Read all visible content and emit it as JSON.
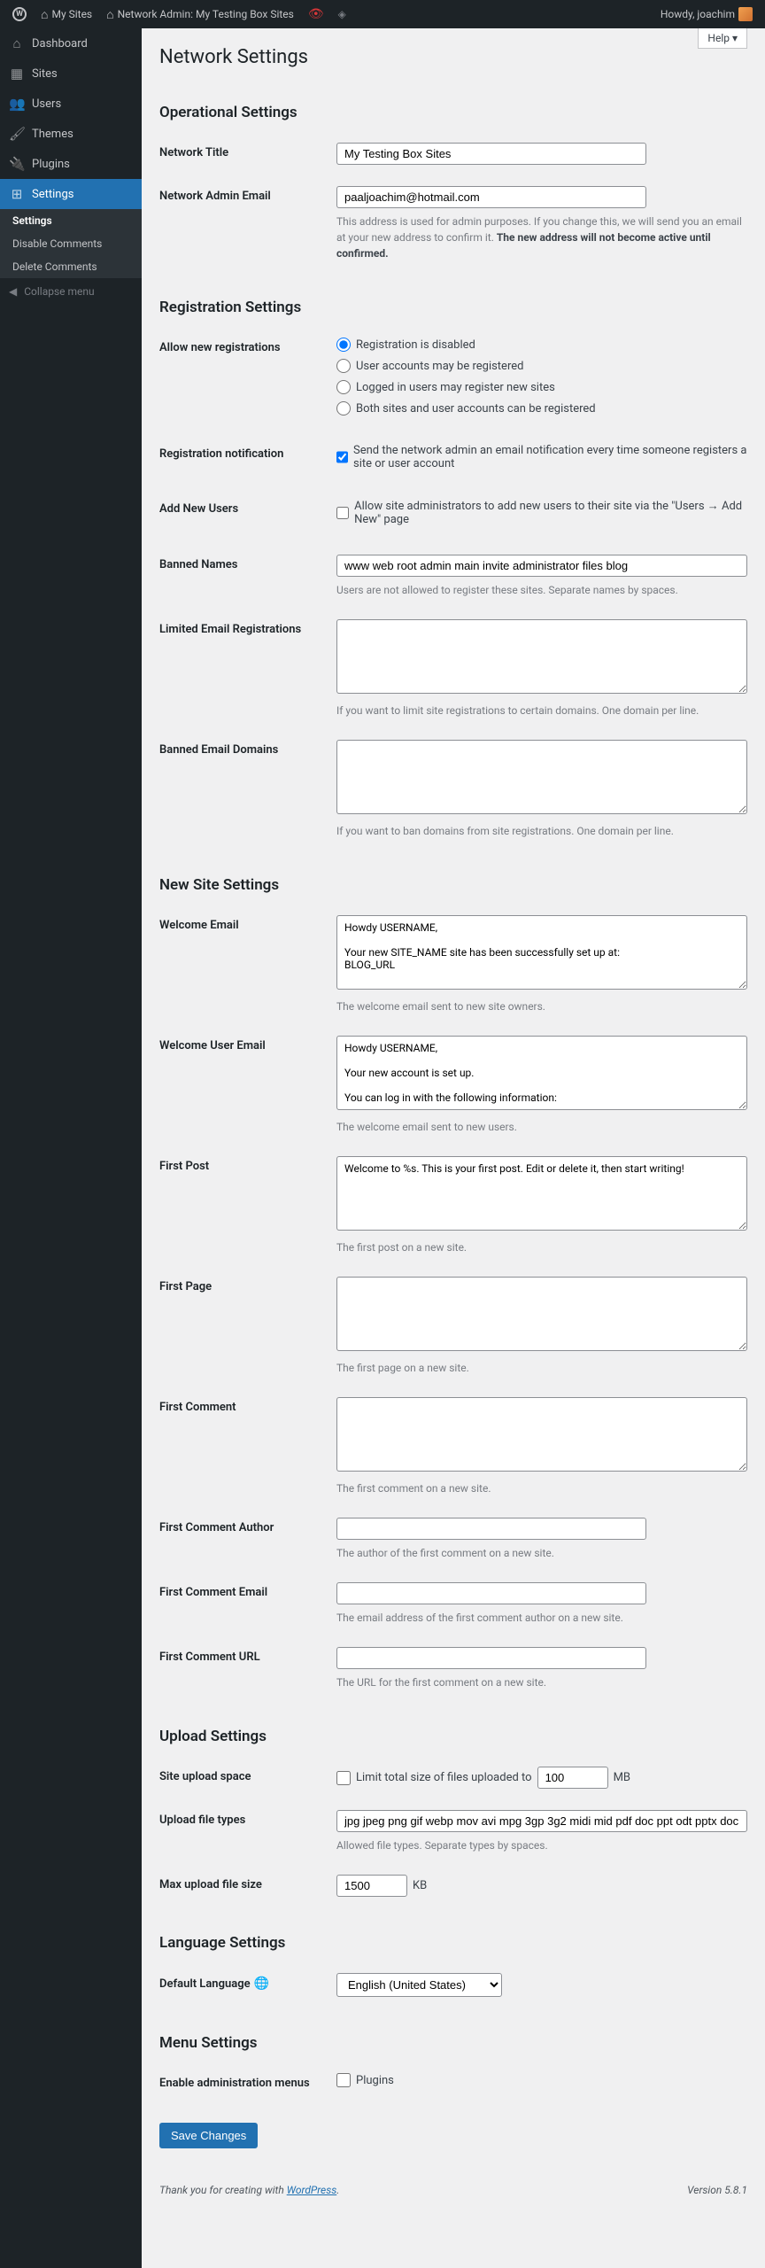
{
  "toolbar": {
    "mySites": "My Sites",
    "networkAdmin": "Network Admin: My Testing Box Sites",
    "howdy": "Howdy, joachim"
  },
  "sidebar": {
    "dashboard": "Dashboard",
    "sites": "Sites",
    "users": "Users",
    "themes": "Themes",
    "plugins": "Plugins",
    "settings": "Settings",
    "subSettings": "Settings",
    "disableComments": "Disable Comments",
    "deleteComments": "Delete Comments",
    "collapse": "Collapse menu"
  },
  "help": "Help",
  "page": {
    "title": "Network Settings",
    "operational": "Operational Settings",
    "registration": "Registration Settings",
    "newSite": "New Site Settings",
    "upload": "Upload Settings",
    "language": "Language Settings",
    "menu": "Menu Settings"
  },
  "labels": {
    "networkTitle": "Network Title",
    "networkAdminEmail": "Network Admin Email",
    "allowReg": "Allow new registrations",
    "regNotif": "Registration notification",
    "addNewUsers": "Add New Users",
    "bannedNames": "Banned Names",
    "limitedEmail": "Limited Email Registrations",
    "bannedEmail": "Banned Email Domains",
    "welcomeEmail": "Welcome Email",
    "welcomeUserEmail": "Welcome User Email",
    "firstPost": "First Post",
    "firstPage": "First Page",
    "firstComment": "First Comment",
    "firstCommentAuthor": "First Comment Author",
    "firstCommentEmail": "First Comment Email",
    "firstCommentURL": "First Comment URL",
    "siteUploadSpace": "Site upload space",
    "uploadFileTypes": "Upload file types",
    "maxUpload": "Max upload file size",
    "defaultLang": "Default Language",
    "enableAdminMenus": "Enable administration menus"
  },
  "values": {
    "networkTitle": "My Testing Box Sites",
    "networkAdminEmail": "paaljoachim@hotmail.com",
    "bannedNames": "www web root admin main invite administrator files blog",
    "welcomeEmail": "Howdy USERNAME,\n\nYour new SITE_NAME site has been successfully set up at:\nBLOG_URL",
    "welcomeUserEmail": "Howdy USERNAME,\n\nYour new account is set up.\n\nYou can log in with the following information:",
    "firstPost": "Welcome to %s. This is your first post. Edit or delete it, then start writing!",
    "uploadSpace": "100",
    "uploadFileTypes": "jpg jpeg png gif webp mov avi mpg 3gp 3g2 midi mid pdf doc ppt odt pptx doc",
    "maxUpload": "1500",
    "defaultLang": "English (United States)"
  },
  "desc": {
    "adminEmail1": "This address is used for admin purposes. If you change this, we will send you an email at your new address to confirm it. ",
    "adminEmail2": "The new address will not become active until confirmed.",
    "bannedNames": "Users are not allowed to register these sites. Separate names by spaces.",
    "limitedEmail": "If you want to limit site registrations to certain domains. One domain per line.",
    "bannedEmail": "If you want to ban domains from site registrations. One domain per line.",
    "welcomeEmail": "The welcome email sent to new site owners.",
    "welcomeUserEmail": "The welcome email sent to new users.",
    "firstPost": "The first post on a new site.",
    "firstPage": "The first page on a new site.",
    "firstComment": "The first comment on a new site.",
    "firstCommentAuthor": "The author of the first comment on a new site.",
    "firstCommentEmail": "The email address of the first comment author on a new site.",
    "firstCommentURL": "The URL for the first comment on a new site.",
    "uploadFileTypes": "Allowed file types. Separate types by spaces."
  },
  "radios": {
    "regDisabled": "Registration is disabled",
    "userAccounts": "User accounts may be registered",
    "loggedIn": "Logged in users may register new sites",
    "bothSites": "Both sites and user accounts can be registered"
  },
  "checks": {
    "regNotif": "Send the network admin an email notification every time someone registers a site or user account",
    "addNewUsers": "Allow site administrators to add new users to their site via the \"Users → Add New\" page",
    "limitUpload": "Limit total size of files uploaded to",
    "plugins": "Plugins"
  },
  "units": {
    "mb": "MB",
    "kb": "KB"
  },
  "save": "Save Changes",
  "footer": {
    "thanks": "Thank you for creating with ",
    "wp": "WordPress",
    "period": ".",
    "version": "Version 5.8.1"
  }
}
